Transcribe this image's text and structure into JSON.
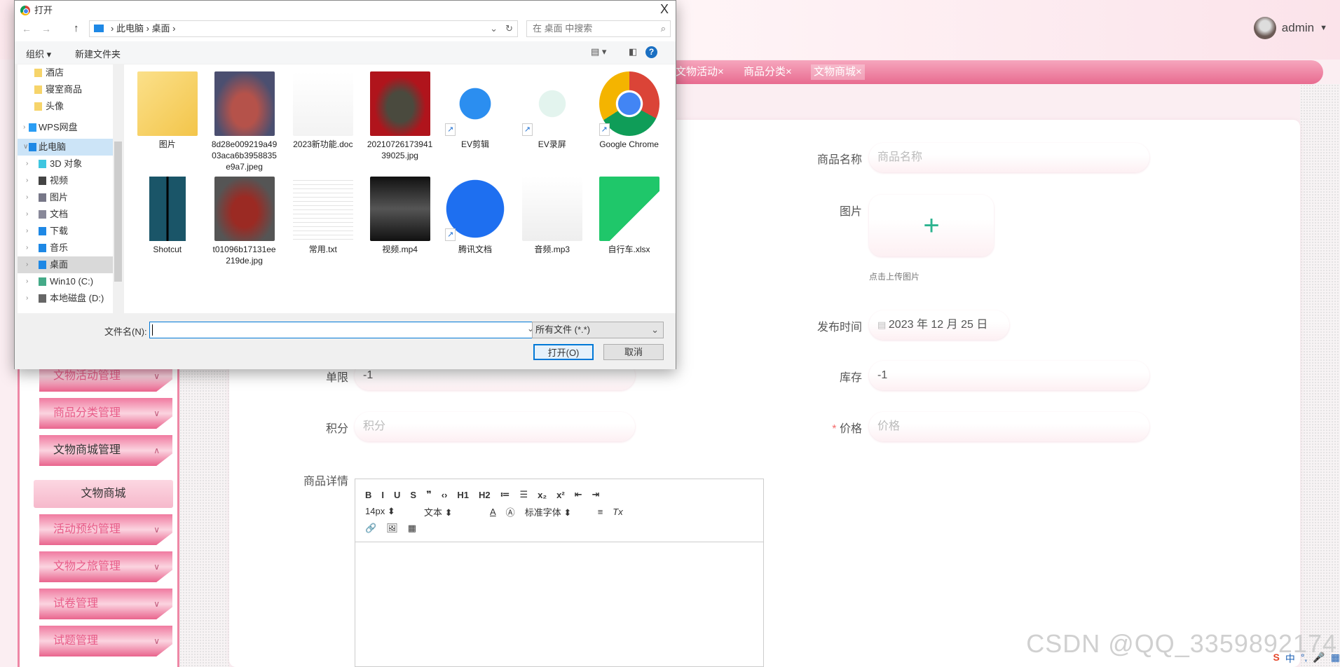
{
  "header": {
    "user": "admin",
    "dropdown_icon": "caret-down-icon"
  },
  "tabs": [
    {
      "label": "文物活动×"
    },
    {
      "label": "商品分类×"
    },
    {
      "label": "文物商城×",
      "active": true
    }
  ],
  "sidebar": {
    "items": [
      {
        "label": "文物活动管理",
        "chevron": "∨"
      },
      {
        "label": "商品分类管理",
        "chevron": "∨"
      },
      {
        "label": "文物商城管理",
        "chevron": "∧",
        "open": true
      },
      {
        "label": "活动预约管理",
        "chevron": "∨"
      },
      {
        "label": "文物之旅管理",
        "chevron": "∨"
      },
      {
        "label": "试卷管理",
        "chevron": "∨"
      },
      {
        "label": "试题管理",
        "chevron": "∨"
      }
    ],
    "subitem": "文物商城"
  },
  "form": {
    "name_label": "商品名称",
    "name_placeholder": "商品名称",
    "image_label": "图片",
    "upload_hint": "点击上传图片",
    "date_label": "发布时间",
    "date_value": "2023 年 12 月 25 日",
    "stock_label": "库存",
    "stock_value": "-1",
    "price_label": "价格",
    "price_placeholder": "价格",
    "price_required": "*",
    "limit_label": "单限",
    "limit_value": "-1",
    "points_label": "积分",
    "points_placeholder": "积分",
    "detail_label": "商品详情"
  },
  "editor": {
    "row1": [
      "B",
      "I",
      "U",
      "S",
      "❞",
      "‹›",
      "H1",
      "H2",
      "≔",
      "☰",
      "x₂",
      "x²",
      "⇤",
      "⇥"
    ],
    "font_size": "14px",
    "format": "文本",
    "font_family": "标准字体",
    "row2_icons": [
      "A",
      "Ⓐ",
      "≡",
      "Tx"
    ],
    "row3_icons": [
      "🔗",
      "🖼",
      "▦"
    ]
  },
  "dialog": {
    "title": "打开",
    "close": "X",
    "breadcrumb": [
      "此电脑",
      "桌面"
    ],
    "search_placeholder": "在 桌面 中搜索",
    "organize": "组织 ▾",
    "new_folder": "新建文件夹",
    "nav": [
      {
        "label": "酒店"
      },
      {
        "label": "寝室商品"
      },
      {
        "label": "头像"
      },
      {
        "label": "WPS网盘"
      },
      {
        "label": "此电脑"
      },
      {
        "label": "3D 对象"
      },
      {
        "label": "视频"
      },
      {
        "label": "图片"
      },
      {
        "label": "文档"
      },
      {
        "label": "下载"
      },
      {
        "label": "音乐"
      },
      {
        "label": "桌面"
      },
      {
        "label": "Win10 (C:)"
      },
      {
        "label": "本地磁盘 (D:)"
      }
    ],
    "files": [
      {
        "name": "图片",
        "kind": "folder"
      },
      {
        "name": "8d28e009219a4903aca6b3958835e9a7.jpeg",
        "kind": "image-bowl"
      },
      {
        "name": "2023新功能.doc",
        "kind": "wps-doc"
      },
      {
        "name": "2021072617394139025.jpg",
        "kind": "image-bronze"
      },
      {
        "name": "EV剪辑",
        "kind": "shortcut-ev-edit"
      },
      {
        "name": "EV录屏",
        "kind": "shortcut-ev-record"
      },
      {
        "name": "Google Chrome",
        "kind": "shortcut-chrome"
      },
      {
        "name": "Shotcut",
        "kind": "app-shotcut"
      },
      {
        "name": "t01096b17131ee219de.jpg",
        "kind": "image-teapot"
      },
      {
        "name": "常用.txt",
        "kind": "txt"
      },
      {
        "name": "视频.mp4",
        "kind": "video"
      },
      {
        "name": "腾讯文档",
        "kind": "shortcut-tencent-docs"
      },
      {
        "name": "音频.mp3",
        "kind": "mp3"
      },
      {
        "name": "自行车.xlsx",
        "kind": "xlsx"
      }
    ],
    "filename_label": "文件名(N):",
    "filename_value": "",
    "filetype": "所有文件 (*.*)",
    "open": "打开(O)",
    "cancel": "取消"
  },
  "watermark": "CSDN @QQ_3359892174",
  "colors": {
    "accent": "#e86b90",
    "plus": "#2cb38f",
    "required": "#f56c6c"
  }
}
